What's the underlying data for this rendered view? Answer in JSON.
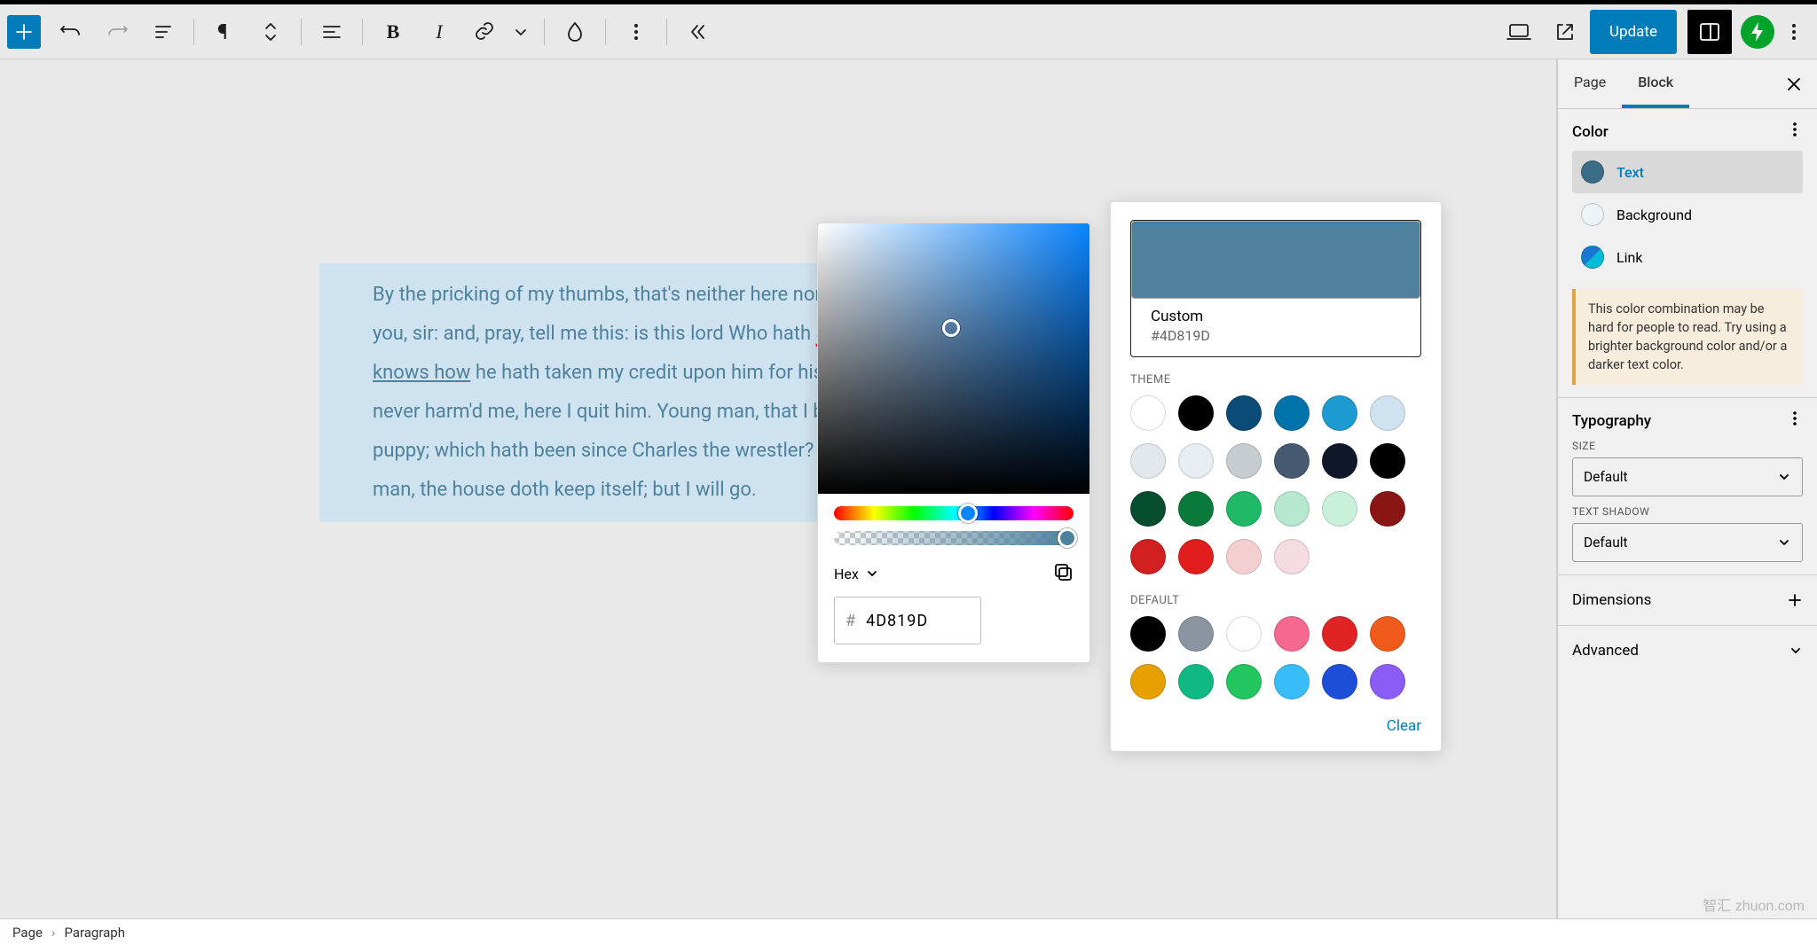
{
  "toolbar": {
    "update_label": "Update"
  },
  "canvas": {
    "paragraph_html": "By the pricking of my thumbs, that's neither here nor there. I thank you, sir: and, pray, tell me this: is this lord Who hath <span class=\"spell\">abus'd</span> me as <a href=\"#\">he knows how</a> he hath taken my credit upon him for his own; but he never harm'd me, here I quit him. Young man, that I brought up of a puppy; which hath been since Charles the wrestler? But, poor old man, the house doth keep itself; but I will go."
  },
  "picker": {
    "format_label": "Hex",
    "hash": "#",
    "hex_value": "4D819D"
  },
  "swatches": {
    "custom_label": "Custom",
    "custom_code": "#4D819D",
    "theme_label": "THEME",
    "default_label": "DEFAULT",
    "clear_label": "Clear",
    "theme_colors": [
      "#ffffff",
      "#000000",
      "#0a4b78",
      "#0073aa",
      "#1d9bd1",
      "#cfe2ef",
      "#e2e8ee",
      "#e8edf2",
      "#c7ccd1",
      "#455a70",
      "#0f172a",
      "#000000",
      "#064c2f",
      "#0a7a3a",
      "#1fb866",
      "#b6e7cf",
      "#c9f0db",
      "#8a1515",
      "#d21f1f",
      "#e11d1d",
      "#f3cfd0",
      "#f6dbe0"
    ],
    "default_colors": [
      "#000000",
      "#8b94a1",
      "#ffffff",
      "#f56991",
      "#e02424",
      "#f05a1a",
      "#e6a100",
      "#10b981",
      "#22c55e",
      "#38bdf8",
      "#1d4ed8",
      "#8b5cf6"
    ]
  },
  "sidebar": {
    "tabs": {
      "page": "Page",
      "block": "Block"
    },
    "color_heading": "Color",
    "color_rows": {
      "text": "Text",
      "background": "Background",
      "link": "Link"
    },
    "color_swatch": {
      "text": "#3b6d87",
      "background": "#eef3f7"
    },
    "warning": "This color combination may be hard for people to read. Try using a brighter background color and/or a darker text color.",
    "typography_heading": "Typography",
    "size_label": "SIZE",
    "size_value": "Default",
    "shadow_label": "TEXT SHADOW",
    "shadow_value": "Default",
    "dimensions_heading": "Dimensions",
    "advanced_heading": "Advanced"
  },
  "footer": {
    "crumb1": "Page",
    "crumb2": "Paragraph"
  },
  "watermark": "智汇 zhuon.com"
}
